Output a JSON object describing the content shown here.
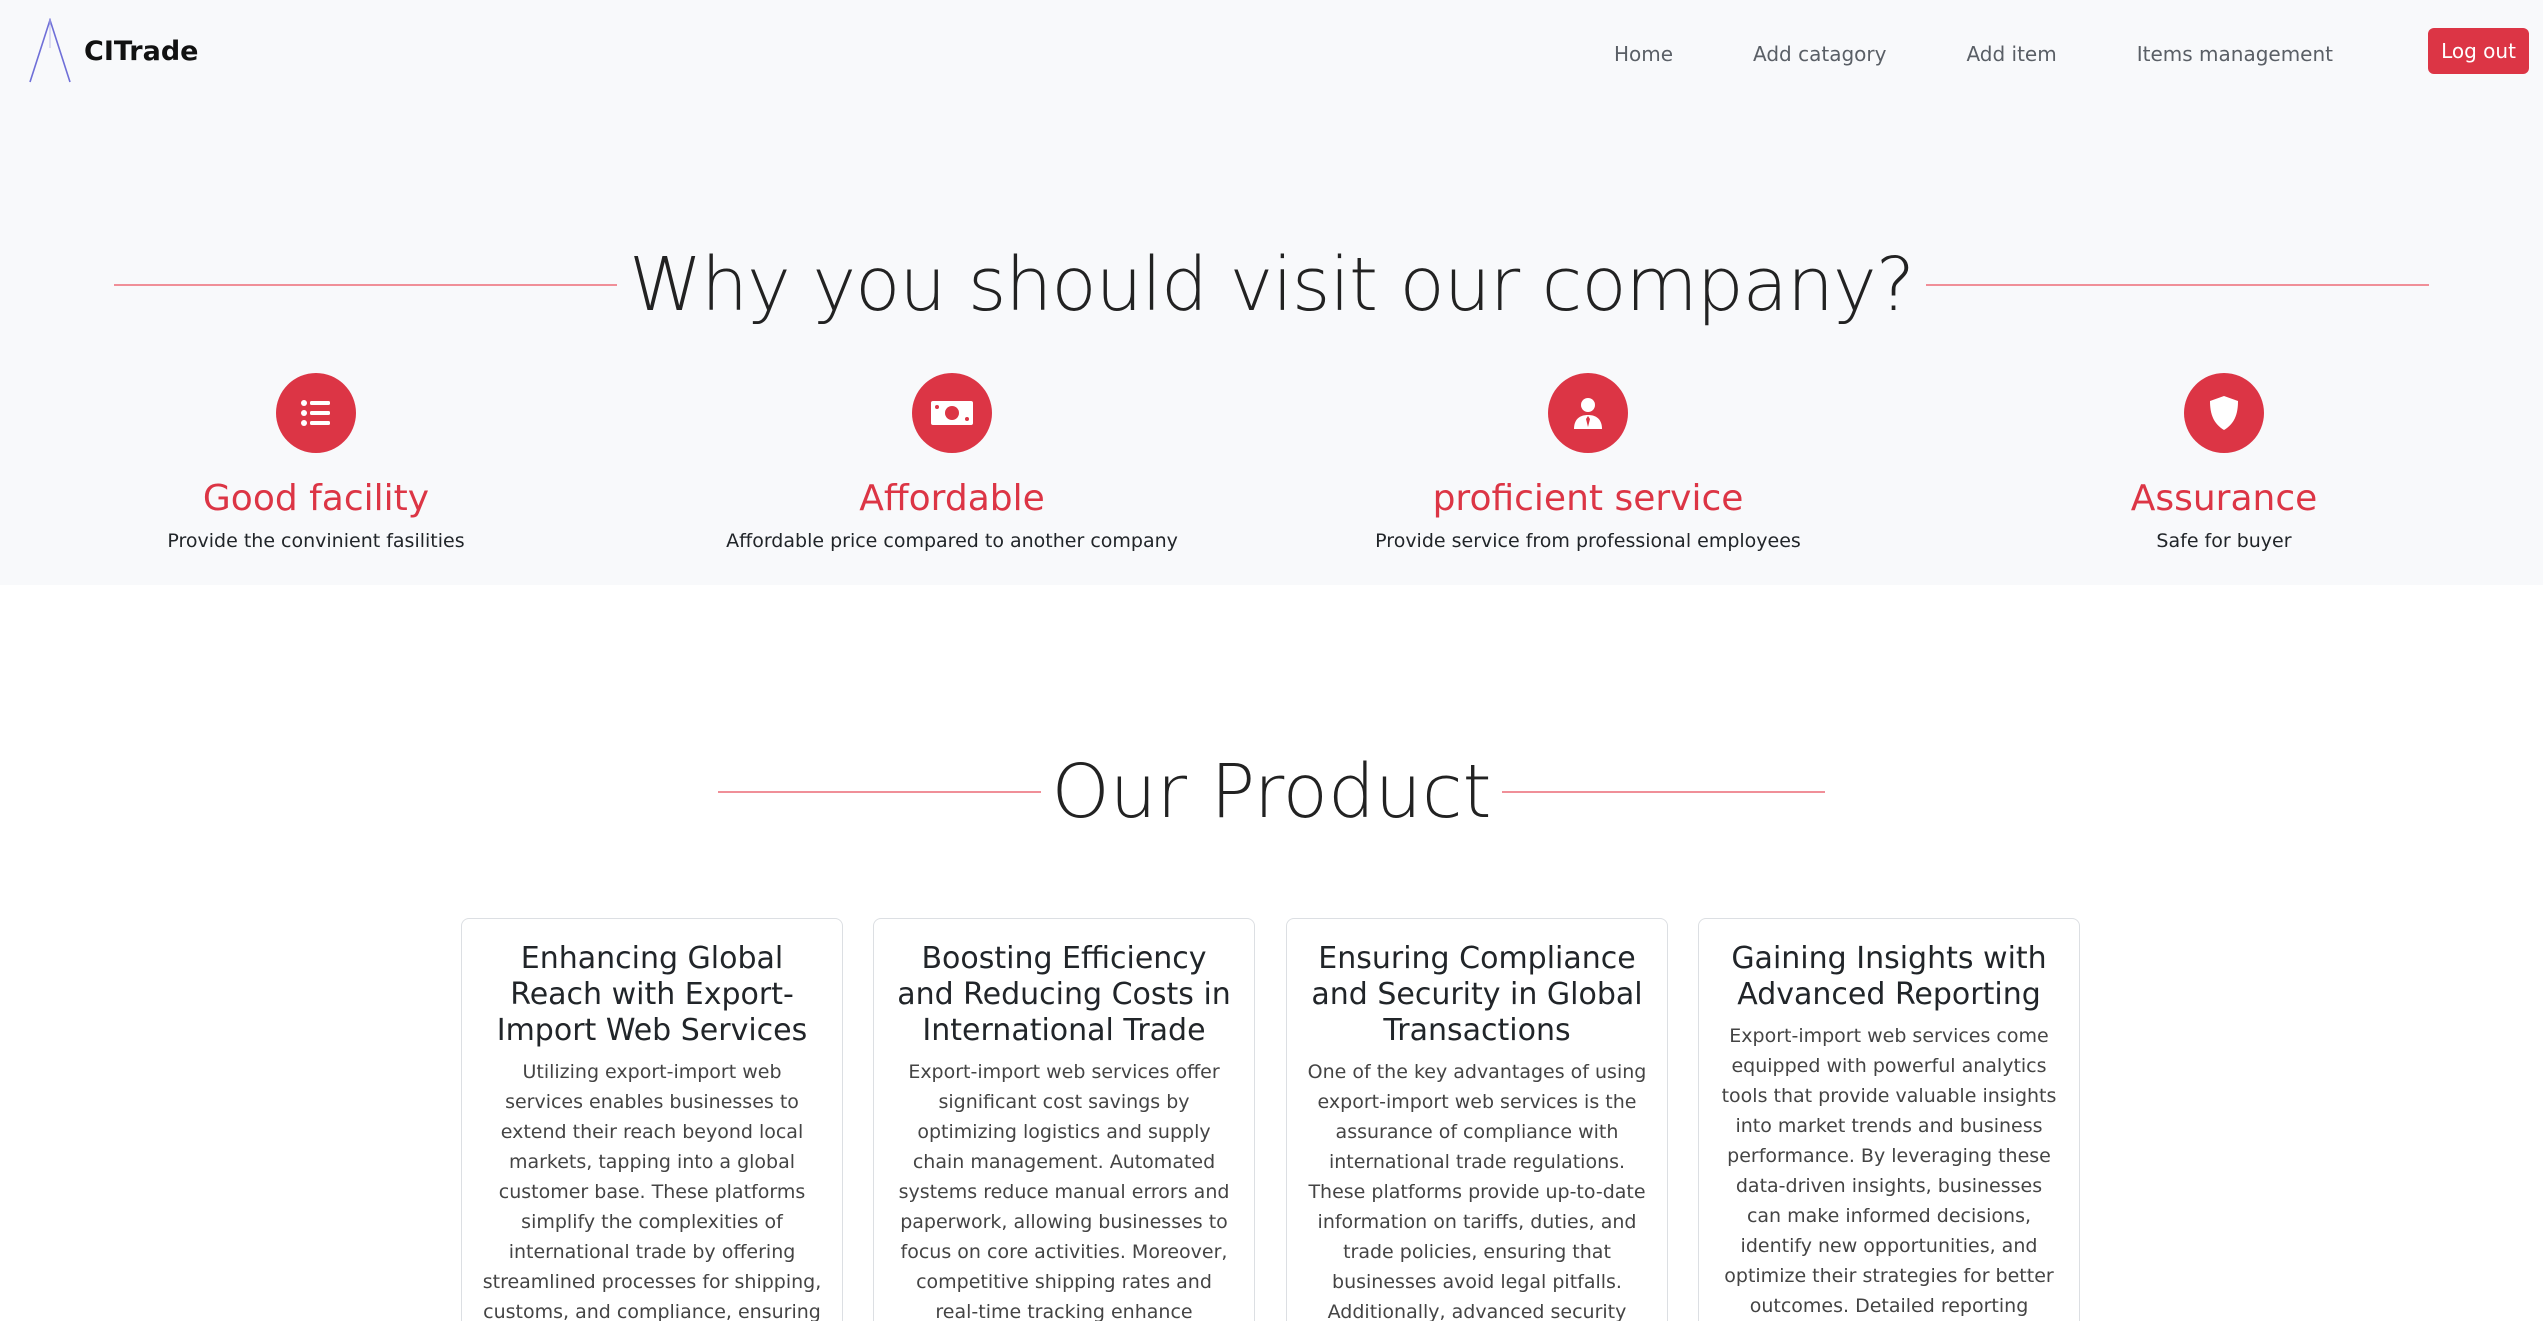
{
  "navbar": {
    "brand": "CITrade",
    "links": [
      "Home",
      "Add catagory",
      "Add item",
      "Items management"
    ],
    "logout": "Log out",
    "accent": "#dc3545"
  },
  "why": {
    "title": "Why you should visit our company?",
    "features": [
      {
        "icon": "list-icon",
        "title": "Good facility",
        "desc": "Provide the convinient fasilities"
      },
      {
        "icon": "money-icon",
        "title": "Affordable",
        "desc": "Affordable price compared to another company"
      },
      {
        "icon": "person-tie-icon",
        "title": "proficient service",
        "desc": "Provide service from professional employees"
      },
      {
        "icon": "shield-icon",
        "title": "Assurance",
        "desc": "Safe for buyer"
      }
    ]
  },
  "product": {
    "title": "Our Product",
    "cards": [
      {
        "title": "Enhancing Global Reach with Export-Import Web Services",
        "text": "Utilizing export-import web services enables businesses to extend their reach beyond local markets, tapping into a global customer base. These platforms simplify the complexities of international trade by offering streamlined processes for shipping, customs, and compliance, ensuring that products reach their destinations"
      },
      {
        "title": "Boosting Efficiency and Reducing Costs in International Trade",
        "text": "Export-import web services offer significant cost savings by optimizing logistics and supply chain management. Automated systems reduce manual errors and paperwork, allowing businesses to focus on core activities. Moreover, competitive shipping rates and real-time tracking enhance operational efficiency and"
      },
      {
        "title": "Ensuring Compliance and Security in Global Transactions",
        "text": "One of the key advantages of using export-import web services is the assurance of compliance with international trade regulations. These platforms provide up-to-date information on tariffs, duties, and trade policies, ensuring that businesses avoid legal pitfalls. Additionally, advanced security"
      },
      {
        "title": "Gaining Insights with Advanced Reporting",
        "text": "Export-import web services come equipped with powerful analytics tools that provide valuable insights into market trends and business performance. By leveraging these data-driven insights, businesses can make informed decisions, identify new opportunities, and optimize their strategies for better outcomes. Detailed reporting features also help"
      }
    ]
  }
}
